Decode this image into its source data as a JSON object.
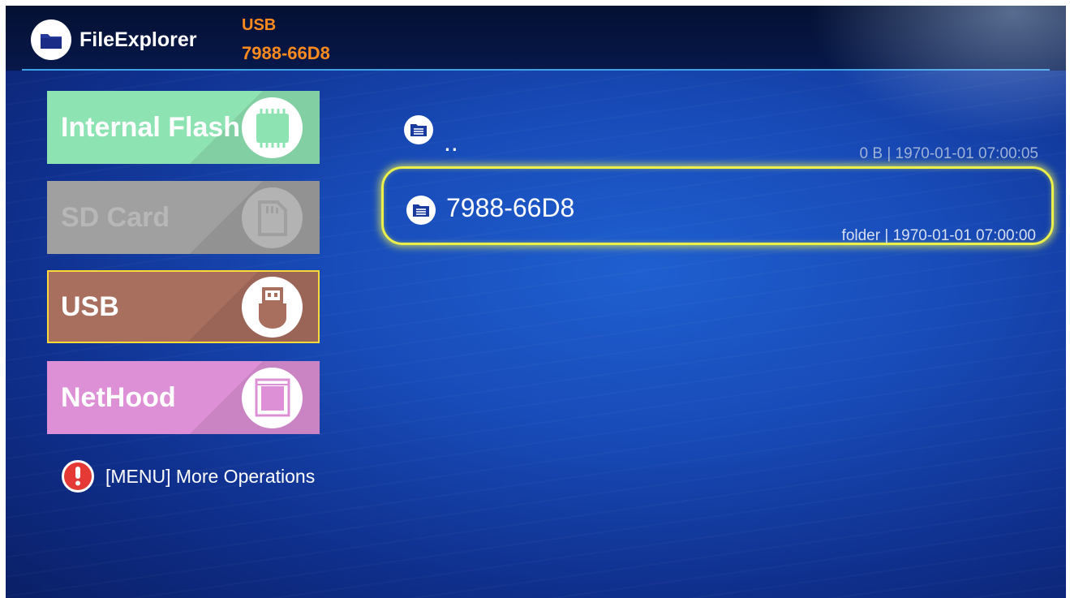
{
  "app": {
    "title": "FileExplorer",
    "icon": "folder-icon"
  },
  "path": {
    "device": "USB",
    "volume": "7988-66D8"
  },
  "colors": {
    "path_text": "#ff8a1e",
    "header_line": "#3fa1e6",
    "selection_glow": "#ecf04a",
    "internal_flash": "#8ee3b3",
    "sd_card": "#a0a0a0",
    "usb": "#a96f5e",
    "nethood": "#de90d6"
  },
  "sidebar": {
    "items": [
      {
        "label": "Internal Flash",
        "icon": "chip-icon",
        "enabled": true,
        "selected": false
      },
      {
        "label": "SD Card",
        "icon": "sd-card-icon",
        "enabled": false,
        "selected": false
      },
      {
        "label": "USB",
        "icon": "usb-drive-icon",
        "enabled": true,
        "selected": true
      },
      {
        "label": "NetHood",
        "icon": "network-folder-icon",
        "enabled": true,
        "selected": false
      }
    ]
  },
  "hint": {
    "text": "[MENU] More Operations",
    "icon": "exclamation-icon"
  },
  "files": [
    {
      "name": "..",
      "meta": "0 B | 1970-01-01 07:00:05",
      "icon": "folder-icon",
      "focused": false
    },
    {
      "name": "7988-66D8",
      "meta": "folder | 1970-01-01 07:00:00",
      "icon": "folder-icon",
      "focused": true
    }
  ]
}
